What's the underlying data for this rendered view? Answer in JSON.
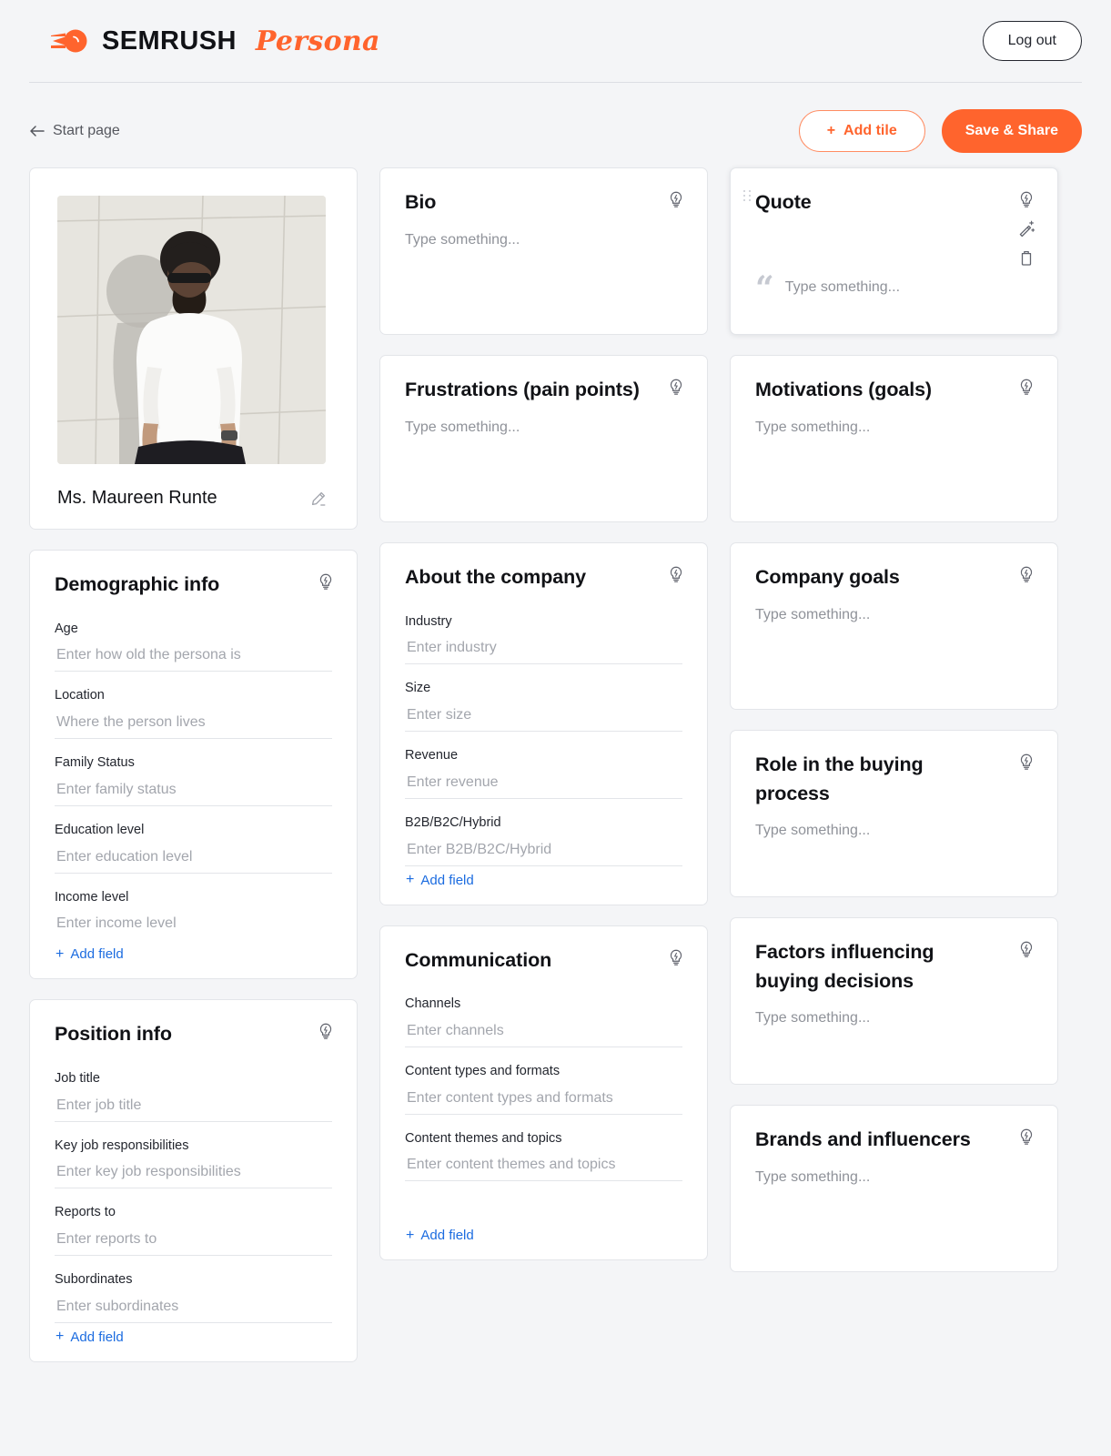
{
  "brand": {
    "name": "SEMRUSH",
    "product": "Persona",
    "accent": "#ff642d",
    "logo_icon": "semrush-comet-icon"
  },
  "header": {
    "logout_label": "Log out"
  },
  "subbar": {
    "back_label": "Start page",
    "back_icon": "arrow-left-icon",
    "add_tile_label": "Add tile",
    "add_tile_plus": "+",
    "save_share_label": "Save & Share"
  },
  "persona": {
    "name": "Ms. Maureen Runte",
    "edit_icon": "pencil-icon",
    "photo_alt": "persona-photo"
  },
  "common": {
    "placeholder": "Type something...",
    "add_field_label": "Add field",
    "add_field_plus": "+",
    "idea_icon": "lightbulb-idea-icon",
    "magic_icon": "magic-wand-icon",
    "delete_icon": "trash-icon",
    "drag_icon": "drag-handle-icon",
    "quote_glyph": "“"
  },
  "tiles": {
    "bio": {
      "title": "Bio",
      "placeholder": "Type something..."
    },
    "quote": {
      "title": "Quote",
      "placeholder": "Type something..."
    },
    "frustrations": {
      "title": "Frustrations (pain points)",
      "placeholder": "Type something..."
    },
    "motivations": {
      "title": "Motivations (goals)",
      "placeholder": "Type something..."
    },
    "company_goals": {
      "title": "Company goals",
      "placeholder": "Type something..."
    },
    "role_buying": {
      "title": "Role in the buying process",
      "placeholder": "Type something..."
    },
    "factors": {
      "title": "Factors influencing buying decisions",
      "placeholder": "Type something..."
    },
    "brands": {
      "title": "Brands and influencers",
      "placeholder": "Type something..."
    },
    "demographic": {
      "title": "Demographic info",
      "fields": [
        {
          "label": "Age",
          "placeholder": "Enter how old the persona is"
        },
        {
          "label": "Location",
          "placeholder": "Where the person lives"
        },
        {
          "label": "Family Status",
          "placeholder": "Enter family status"
        },
        {
          "label": "Education level",
          "placeholder": "Enter education level"
        },
        {
          "label": "Income level",
          "placeholder": "Enter income level"
        }
      ]
    },
    "position": {
      "title": "Position info",
      "fields": [
        {
          "label": "Job title",
          "placeholder": "Enter job title"
        },
        {
          "label": "Key job responsibilities",
          "placeholder": "Enter key job responsibilities"
        },
        {
          "label": "Reports to",
          "placeholder": "Enter reports to"
        },
        {
          "label": "Subordinates",
          "placeholder": "Enter subordinates"
        }
      ]
    },
    "company": {
      "title": "About the company",
      "fields": [
        {
          "label": "Industry",
          "placeholder": "Enter industry"
        },
        {
          "label": "Size",
          "placeholder": "Enter size"
        },
        {
          "label": "Revenue",
          "placeholder": "Enter revenue"
        },
        {
          "label": "B2B/B2C/Hybrid",
          "placeholder": "Enter B2B/B2C/Hybrid"
        }
      ]
    },
    "communication": {
      "title": "Communication",
      "fields": [
        {
          "label": "Channels",
          "placeholder": "Enter channels"
        },
        {
          "label": "Content types and formats",
          "placeholder": "Enter content types and formats"
        },
        {
          "label": "Content themes and topics",
          "placeholder": "Enter content themes and topics"
        }
      ]
    }
  }
}
